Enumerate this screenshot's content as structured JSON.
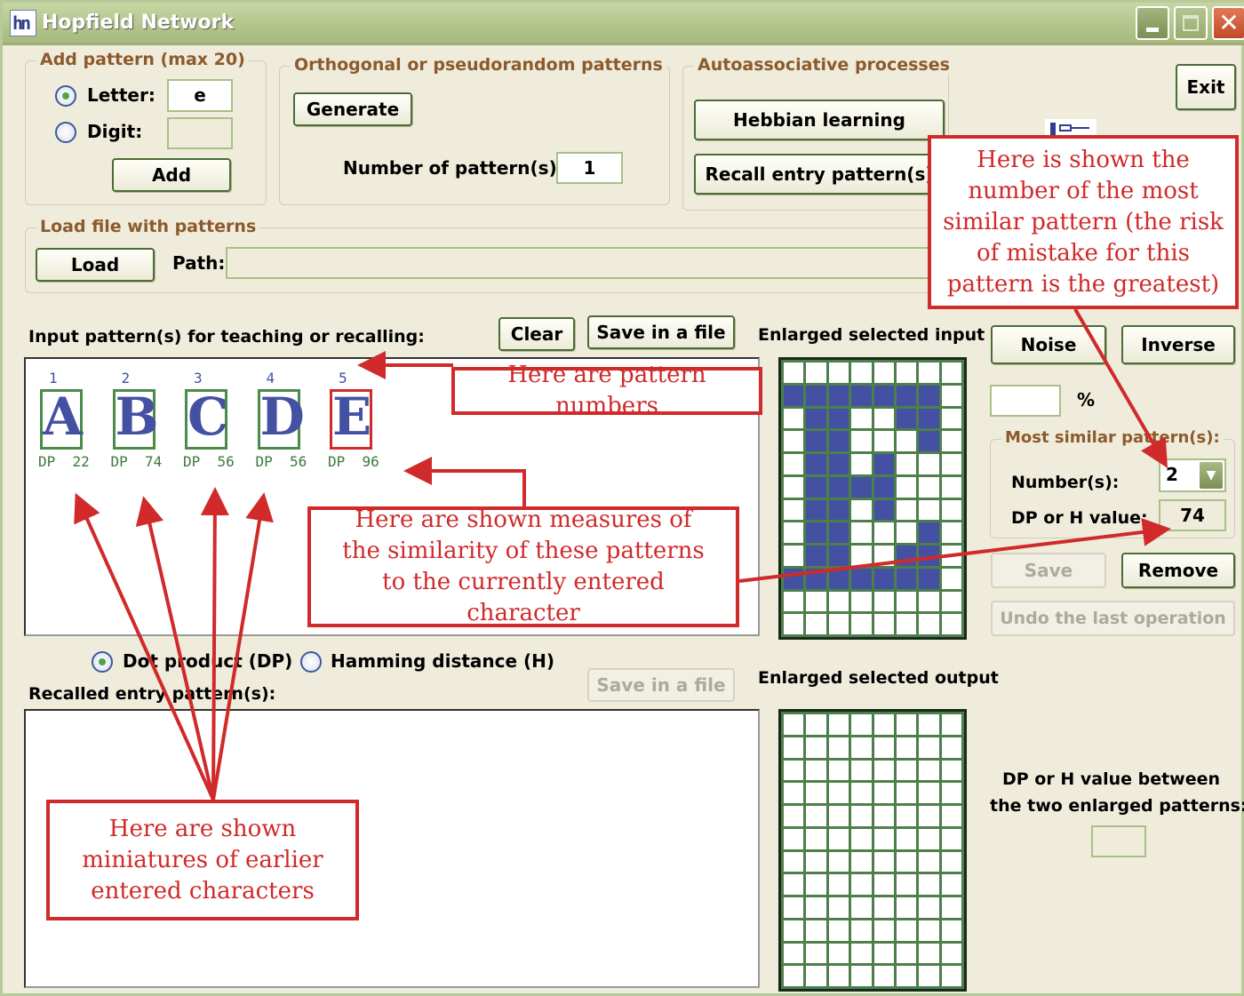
{
  "window": {
    "title": "Hopfield Network",
    "icon": "hopfield-app-icon",
    "controls": [
      "minimize",
      "maximize",
      "close"
    ]
  },
  "add_pattern": {
    "legend": "Add pattern (max 20)",
    "letter_label": "Letter:",
    "letter_value": "e",
    "letter_selected": true,
    "digit_label": "Digit:",
    "digit_value": "",
    "add_button": "Add"
  },
  "orthogonal": {
    "legend": "Orthogonal or pseudorandom patterns",
    "generate_button": "Generate",
    "count_label": "Number of pattern(s):",
    "count_value": "1"
  },
  "autoassociative": {
    "legend": "Autoassociative processes",
    "hebbian_button": "Hebbian learning",
    "recall_button": "Recall entry pattern(s)"
  },
  "exit_button": "Exit",
  "load": {
    "legend": "Load file with patterns",
    "load_button": "Load",
    "path_label": "Path:",
    "path_value": ""
  },
  "input_patterns": {
    "title": "Input pattern(s) for teaching or recalling:",
    "clear_button": "Clear",
    "save_button": "Save in a file",
    "items": [
      {
        "number": "1",
        "glyph": "A",
        "measure": "DP  22",
        "selected": false
      },
      {
        "number": "2",
        "glyph": "B",
        "measure": "DP  74",
        "selected": false
      },
      {
        "number": "3",
        "glyph": "C",
        "measure": "DP  56",
        "selected": false
      },
      {
        "number": "4",
        "glyph": "D",
        "measure": "DP  56",
        "selected": false
      },
      {
        "number": "5",
        "glyph": "E",
        "measure": "DP  96",
        "selected": true
      }
    ]
  },
  "measure_mode": {
    "dot_product": "Dot product (DP)",
    "hamming": "Hamming distance (H)",
    "selected": "dot_product"
  },
  "recalled": {
    "title": "Recalled entry pattern(s):",
    "save_button": "Save in a file",
    "save_enabled": false
  },
  "enlarged_input": {
    "title": "Enlarged selected input",
    "rows": [
      "00000000",
      "11111110",
      "01100110",
      "01100010",
      "01101000",
      "01111000",
      "01101000",
      "01100010",
      "01100110",
      "11111110",
      "00000000",
      "00000000"
    ]
  },
  "enlarged_output": {
    "title": "Enlarged selected output",
    "rows": [
      "00000000",
      "00000000",
      "00000000",
      "00000000",
      "00000000",
      "00000000",
      "00000000",
      "00000000",
      "00000000",
      "00000000",
      "00000000",
      "00000000"
    ]
  },
  "tools": {
    "noise_button": "Noise",
    "inverse_button": "Inverse",
    "noise_percent_value": "",
    "percent_label": "%"
  },
  "most_similar": {
    "legend": "Most similar pattern(s):",
    "numbers_label": "Number(s):",
    "numbers_value": "2",
    "value_label": "DP or H value:",
    "value": "74",
    "save_button": "Save",
    "remove_button": "Remove",
    "undo_button": "Undo the last operation"
  },
  "between": {
    "label_line1": "DP or H value between",
    "label_line2": "the two enlarged patterns:",
    "value": ""
  },
  "annotations": {
    "most_similar_note": "Here is shown the number of the most similar pattern (the risk of mistake for this pattern is the greatest)",
    "pattern_numbers_note": "Here are pattern numbers",
    "measures_note": "Here are shown measures of the similarity of these patterns to the currently entered character",
    "miniatures_note": "Here are shown miniatures of earlier entered characters",
    "color": "#d02a2a"
  }
}
